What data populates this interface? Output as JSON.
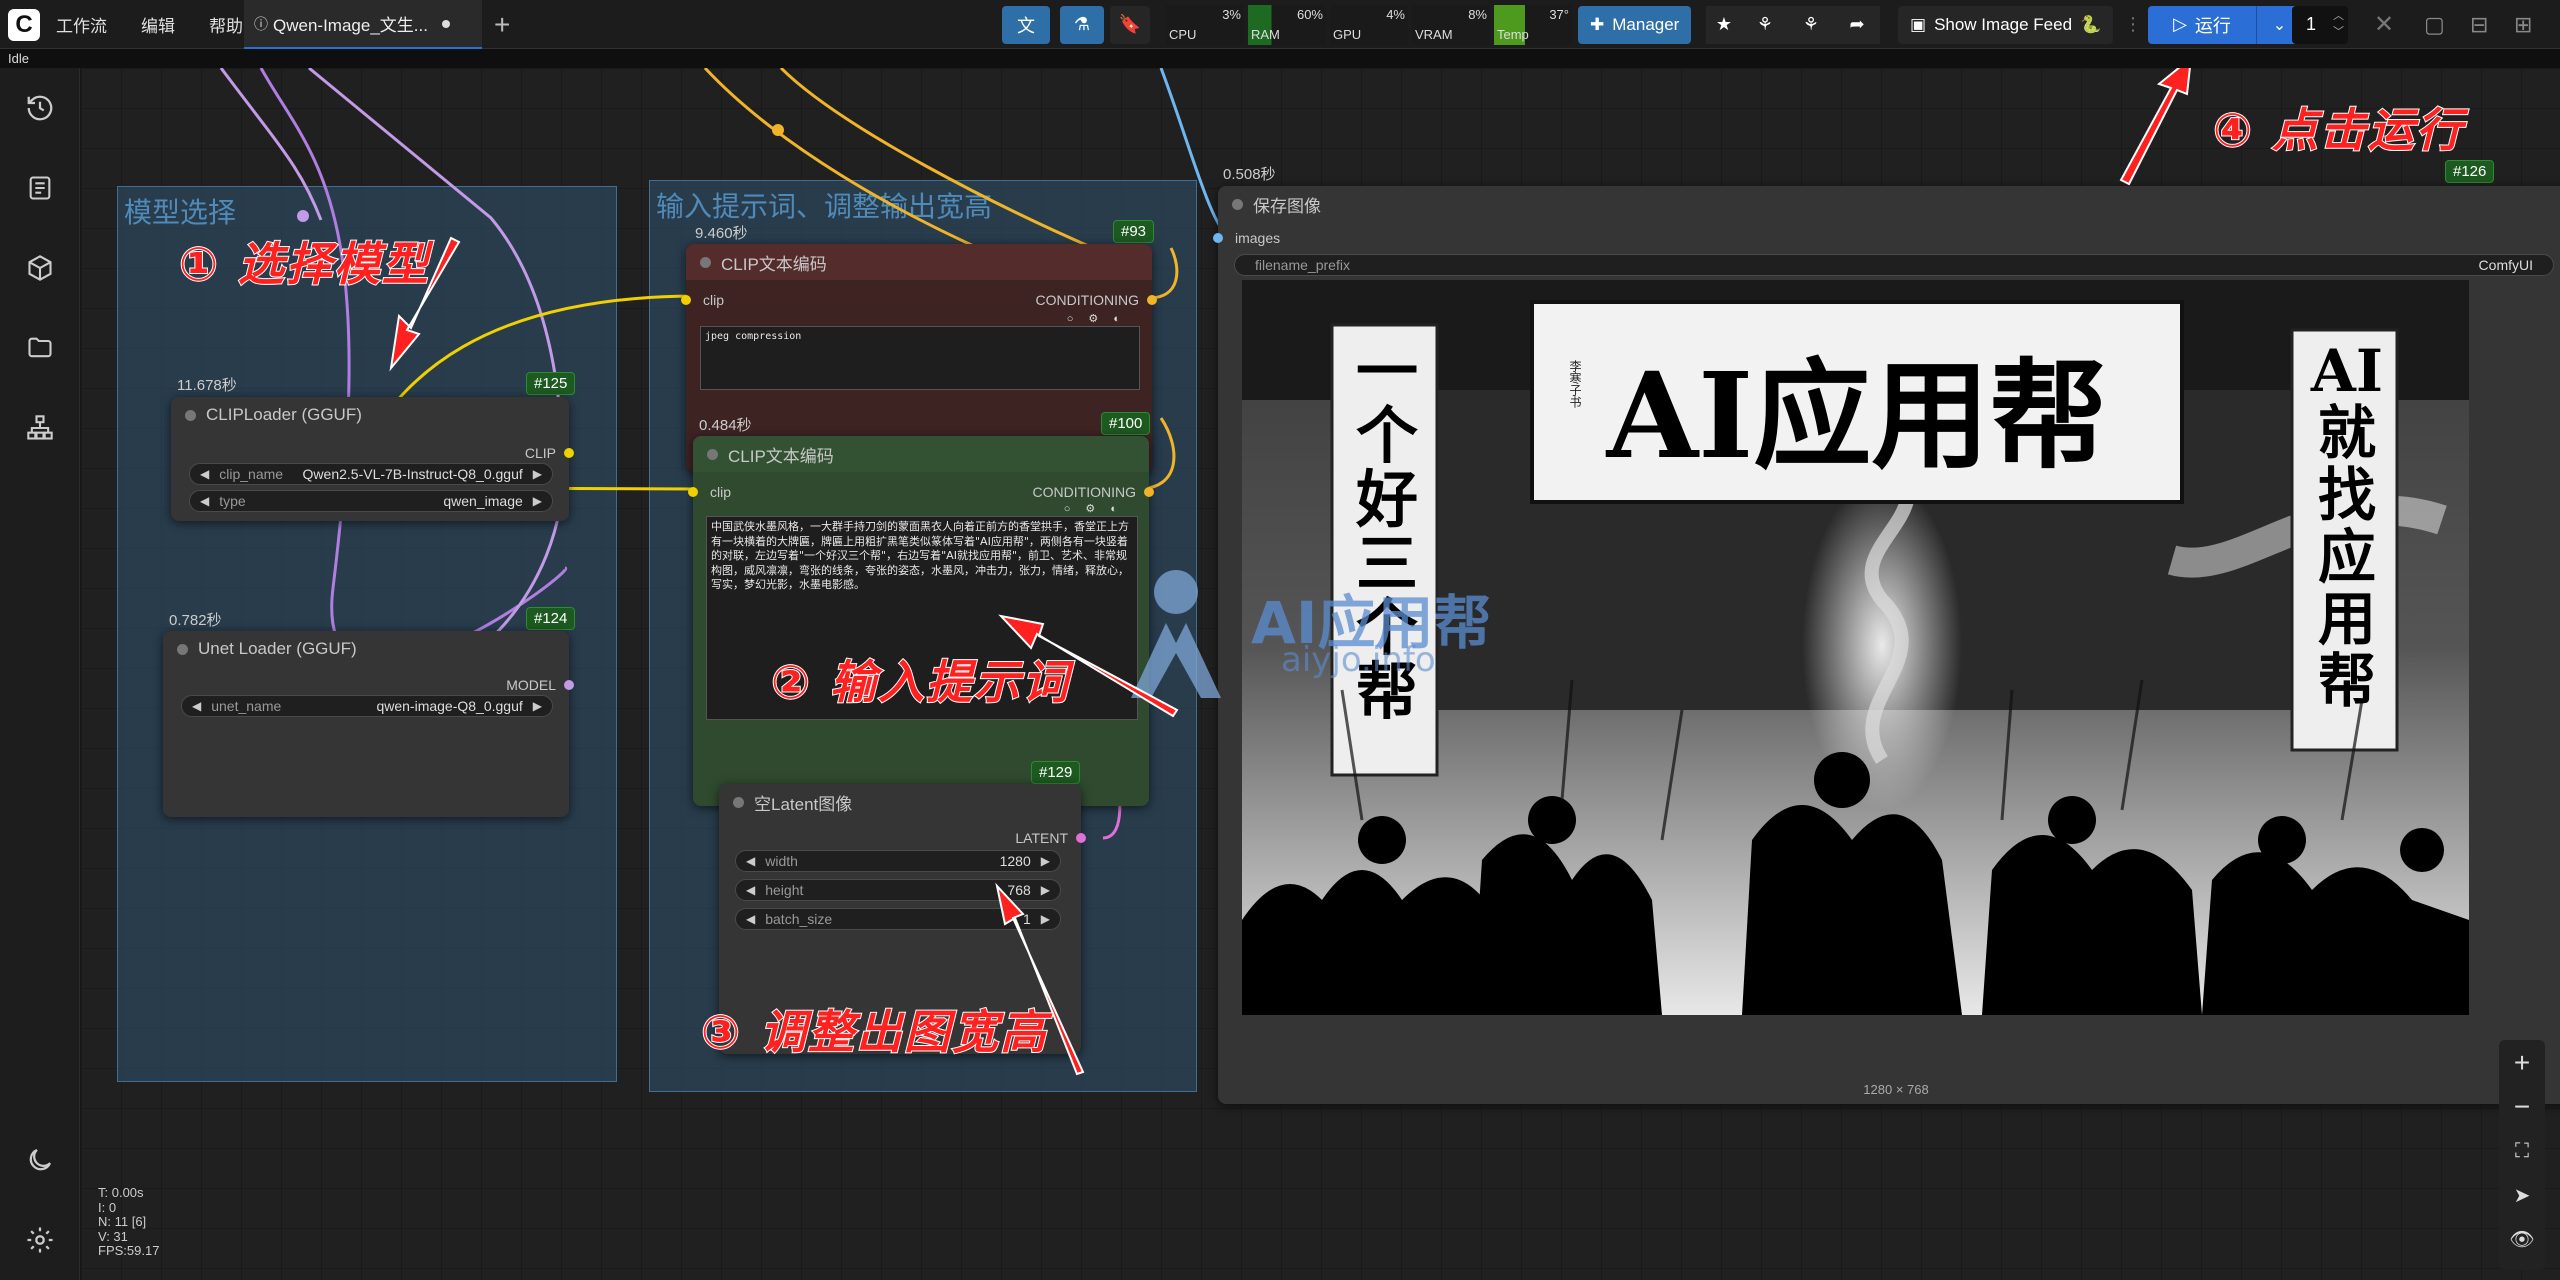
{
  "app": {
    "menu": [
      "工作流",
      "编辑",
      "帮助"
    ],
    "tab_title": "Qwen-Image_文生...",
    "status": "Idle"
  },
  "monitors": [
    {
      "label": "CPU",
      "value": "3%"
    },
    {
      "label": "RAM",
      "value": "60%"
    },
    {
      "label": "GPU",
      "value": "4%"
    },
    {
      "label": "VRAM",
      "value": "8%"
    },
    {
      "label": "Temp",
      "value": "37°"
    }
  ],
  "toolbar": {
    "manager": "Manager",
    "show_feed": "Show Image Feed",
    "run": "运行",
    "queue_count": "1"
  },
  "groups": {
    "model": "模型选择",
    "prompt": "输入提示词、调整输出宽高"
  },
  "nodes": {
    "clip_loader": {
      "time": "11.678秒",
      "id": "#125",
      "title": "CLIPLoader (GGUF)",
      "out": "CLIP",
      "w1_label": "clip_name",
      "w1_value": "Qwen2.5-VL-7B-Instruct-Q8_0.gguf",
      "w2_label": "type",
      "w2_value": "qwen_image"
    },
    "unet_loader": {
      "time": "0.782秒",
      "id": "#124",
      "title": "Unet Loader (GGUF)",
      "out": "MODEL",
      "w1_label": "unet_name",
      "w1_value": "qwen-image-Q8_0.gguf"
    },
    "clip_neg": {
      "time": "9.460秒",
      "id": "#93",
      "title": "CLIP文本编码",
      "in": "clip",
      "out": "CONDITIONING",
      "text": "jpeg compression"
    },
    "clip_pos": {
      "time": "0.484秒",
      "id": "#100",
      "title": "CLIP文本编码",
      "in": "clip",
      "out": "CONDITIONING",
      "text": "中国武侠水墨风格，一大群手持刀剑的蒙面黑衣人向着正前方的香堂拱手，香堂正上方有一块横着的大牌匾，牌匾上用粗扩黑笔类似篆体写着\"AI应用帮\"，两侧各有一块竖着的对联，左边写着\"一个好汉三个帮\"，右边写着\"AI就找应用帮\"，前卫、艺术、非常规构图，威风凛凛，弯张的线条，夸张的姿态，水墨风，冲击力，张力，情绪，释放心，写实，梦幻光影，水墨电影感。"
    },
    "latent": {
      "id": "#129",
      "title": "空Latent图像",
      "out": "LATENT",
      "width_label": "width",
      "width": "1280",
      "height_label": "height",
      "height": "768",
      "batch_label": "batch_size",
      "batch": "1"
    },
    "save": {
      "time": "0.508秒",
      "id": "#126",
      "title": "保存图像",
      "in": "images",
      "prefix_label": "filename_prefix",
      "prefix_value": "ComfyUI",
      "size": "1280 × 768"
    }
  },
  "image_text": {
    "banner": "AI应用帮",
    "left": "一个好三个帮",
    "right": "AI就找应用帮",
    "seal": "李寒子书"
  },
  "watermark": {
    "text": "AI应用帮",
    "sub": "aiyjo.info"
  },
  "annotations": [
    "① 选择模型",
    "② 输入提示词",
    "③ 调整出图宽高",
    "④ 点击运行"
  ],
  "stats": [
    "T: 0.00s",
    "I: 0",
    "N: 11 [6]",
    "V: 31",
    "FPS:59.17"
  ],
  "colors": {
    "accent": "#2b6fd6",
    "annotation": "#ff2020",
    "group": "#345f82"
  }
}
